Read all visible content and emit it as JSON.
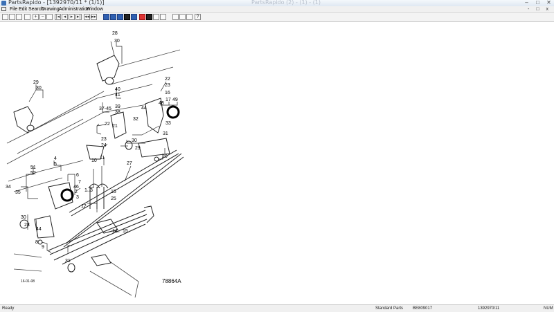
{
  "window": {
    "title": "PartsRapido - [1392970/11 * (1/1)]",
    "ghost_title": "PartsRapido (2) - (1) - (1)",
    "minimize": "–",
    "maximize": "□",
    "close": "✕"
  },
  "menu": {
    "items": [
      "File",
      "Edit",
      "Search",
      "Drawing",
      "Administration",
      "Window"
    ],
    "mdi_controls": "- □ x"
  },
  "toolbar": {
    "buttons": [
      {
        "icon": "new-icon",
        "glyph": ""
      },
      {
        "icon": "open-icon",
        "glyph": ""
      },
      {
        "icon": "save-icon",
        "glyph": ""
      },
      {
        "icon": "print-icon",
        "glyph": ""
      },
      {
        "icon": "zoom-in-icon",
        "glyph": "+"
      },
      {
        "icon": "zoom-out-icon",
        "glyph": "−"
      },
      {
        "icon": "zoom-fit-icon",
        "glyph": ""
      },
      {
        "icon": "first-page-icon",
        "glyph": "|◂"
      },
      {
        "icon": "prev-icon",
        "glyph": "◂"
      },
      {
        "icon": "next-icon",
        "glyph": "▸"
      },
      {
        "icon": "last-page-icon",
        "glyph": "▸|"
      },
      {
        "icon": "prev-drawing-icon",
        "glyph": "◂◂"
      },
      {
        "icon": "next-drawing-icon",
        "glyph": "▸▸"
      },
      {
        "icon": "truck-icon",
        "glyph": ""
      },
      {
        "icon": "parts-icon",
        "glyph": ""
      },
      {
        "icon": "cart-icon",
        "glyph": ""
      },
      {
        "icon": "compare-icon",
        "glyph": ""
      },
      {
        "icon": "gear-icon",
        "glyph": ""
      },
      {
        "icon": "record-icon",
        "glyph": ""
      },
      {
        "icon": "stop-icon",
        "glyph": ""
      },
      {
        "icon": "grid-icon",
        "glyph": ""
      },
      {
        "icon": "target-icon",
        "glyph": ""
      },
      {
        "icon": "camera-icon",
        "glyph": ""
      },
      {
        "icon": "globe-icon",
        "glyph": ""
      },
      {
        "icon": "layers-icon",
        "glyph": ""
      },
      {
        "icon": "help-icon",
        "glyph": "?"
      }
    ]
  },
  "drawing": {
    "callouts": [
      "28",
      "30",
      "29",
      "30",
      "22",
      "23",
      "16",
      "17",
      "49",
      "40",
      "41",
      "39",
      "38",
      "37-45",
      "44",
      "48",
      "22",
      "21",
      "32",
      "30",
      "29",
      "33",
      "31",
      "20",
      "23",
      "24",
      "10",
      "11",
      "27",
      "4",
      "5",
      "51",
      "52",
      "6",
      "7",
      "46",
      "2",
      "3",
      "34",
      "35",
      "1",
      "3",
      "12",
      "15",
      "25",
      "30",
      "28",
      "44",
      "14",
      "15",
      "8",
      "9",
      "31"
    ],
    "date_code": "16-01-08",
    "drawing_number": "78864A"
  },
  "status": {
    "ready": "Ready",
    "catalog": "Standard Parts",
    "code": "BE809017",
    "doc": "1392970/11",
    "mode": "NUM"
  }
}
